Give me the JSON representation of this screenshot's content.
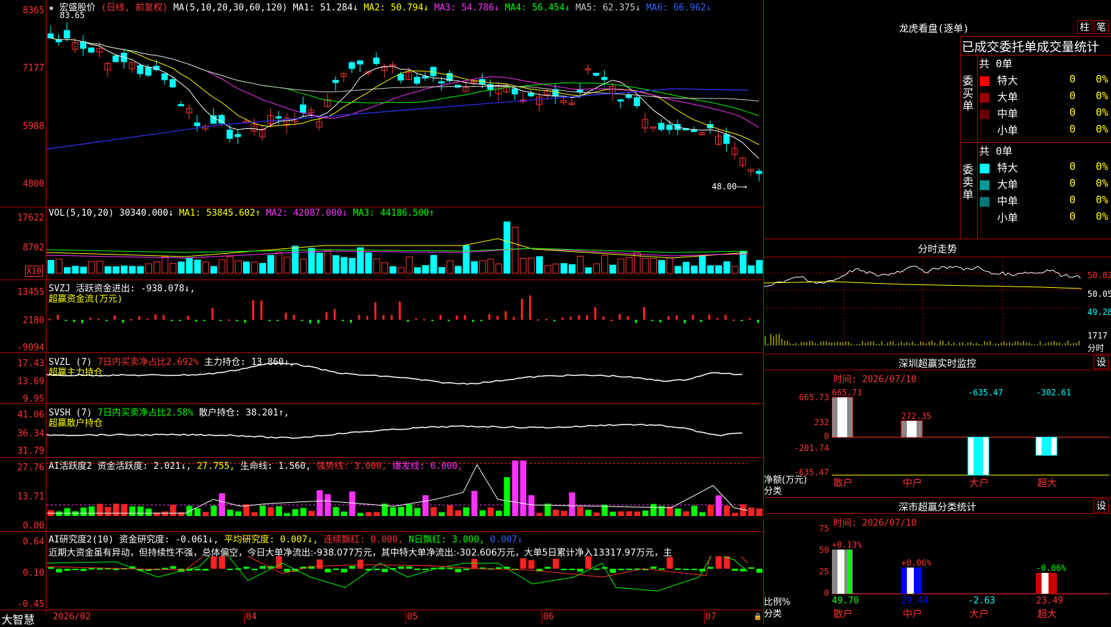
{
  "stock": {
    "name": "宏盛股价",
    "mode": "(日线, 前复权)"
  },
  "price_panel": {
    "ma_label": "MA(5,10,20,30,60,120)",
    "mas": [
      {
        "label": "MA1: 51.284↓",
        "color": "#ffffff"
      },
      {
        "label": "MA2: 50.794↓",
        "color": "#ffff00"
      },
      {
        "label": "MA3: 54.786↓",
        "color": "#ff33ff"
      },
      {
        "label": "MA4: 56.454↓",
        "color": "#00ff00"
      },
      {
        "label": "MA5: 62.375↓",
        "color": "#cccccc"
      },
      {
        "label": "MA6: 66.962↓",
        "color": "#3366ff"
      }
    ],
    "y_ticks": [
      "8365",
      "7177",
      "5988",
      "4800"
    ],
    "high_mark": "83.65",
    "low_mark": "48.00"
  },
  "vol_panel": {
    "title": "VOL(5,10,20)",
    "value": "30340.000↓",
    "ma1": "MA1: 53845.602↑",
    "ma2": "MA2: 42087.000↓",
    "ma3": "MA3: 44186.500↑",
    "y_ticks": [
      "17622",
      "8702"
    ],
    "unit": "X10"
  },
  "svzj_panel": {
    "title": "SVZJ",
    "label": "活跃资金进出: -938.078↓,",
    "sub": "超赢资金流(万元)",
    "y_ticks": [
      "13455",
      "2180",
      "-9094"
    ]
  },
  "svzl_panel": {
    "title": "SVZL (7)",
    "ratio": "7日内买卖净占比2.692%",
    "hold": "主力持仓: 13.860↓,",
    "sub": "超赢主力持仓",
    "y_ticks": [
      "17.43",
      "13.69",
      "9.95"
    ]
  },
  "svsh_panel": {
    "title": "SVSH (7)",
    "ratio": "7日内买卖净占比2.58%",
    "hold": "散户持仓: 38.201↑,",
    "sub": "超赢散户持仓",
    "y_ticks": [
      "41.06",
      "36.34",
      "31.79"
    ]
  },
  "ai_active_panel": {
    "title": "AI活跃度2",
    "a": "资金活跃度: 2.021↓,",
    "b": "27.755,",
    "c": "生命线: 1.560,",
    "d": "强势线: 3.000,",
    "e": "爆发线: 6.000,",
    "y_ticks": [
      "27.76",
      "13.71",
      "0.00"
    ]
  },
  "ai_research_panel": {
    "title": "AI研究度2(10)",
    "a": "资金研究度: -0.061↓,",
    "b": "平均研究度: 0.007↓,",
    "c": "连续飘红: 0.000,",
    "d": "N日飘红: 3.000,",
    "e": "0.007↓",
    "comment": "近期大资金虽有异动，但持续性不强，总体偏空，今日大单净流出:-938.077万元，其中特大单净流出:-302.606万元，大单5日累计净入13317.97万元，主",
    "y_ticks": [
      "0.64",
      "0.10",
      "-0.45"
    ]
  },
  "x_axis": {
    "brand": "大智慧",
    "labels": [
      "2026/02",
      "04",
      "05",
      "06",
      "07"
    ]
  },
  "right": {
    "dragon_title": "龙虎看盘(逐单)",
    "btn1": "柱",
    "btn2": "笔",
    "tabs_title": "已成交委托单成交量统计",
    "buy": {
      "label_chars": [
        "委",
        "买",
        "单"
      ],
      "total": "共 0单",
      "rows": [
        {
          "name": "特大",
          "v": "0",
          "p": "0%",
          "color": "#ff0000"
        },
        {
          "name": "大单",
          "v": "0",
          "p": "0%",
          "color": "#990000"
        },
        {
          "name": "中单",
          "v": "0",
          "p": "0%",
          "color": "#660000"
        },
        {
          "name": "小单",
          "v": "0",
          "p": "0%",
          "color": ""
        }
      ]
    },
    "sell": {
      "label_chars": [
        "委",
        "卖",
        "单"
      ],
      "total": "共 0单",
      "rows": [
        {
          "name": "特大",
          "v": "0",
          "p": "0%",
          "color": "#00ffff"
        },
        {
          "name": "大单",
          "v": "0",
          "p": "0%",
          "color": "#009999"
        },
        {
          "name": "中单",
          "v": "0",
          "p": "0%",
          "color": "#007777"
        },
        {
          "name": "小单",
          "v": "0",
          "p": "0%",
          "color": ""
        }
      ]
    },
    "intraday": {
      "title": "分时走势",
      "y_ticks": [
        "50.82",
        "50.05",
        "49.28"
      ],
      "vol": "1717",
      "vol_label": "分时"
    },
    "monitor": {
      "title": "深圳超赢实时监控",
      "btn": "设",
      "time": "时间: 2026/07/10",
      "y_ticks": [
        "665.73",
        "232",
        "0",
        "-201.74",
        "-635.47"
      ],
      "ylabel1": "净额(万元)",
      "ylabel2": "分类",
      "cats": [
        "散户",
        "中户",
        "大户",
        "超大"
      ]
    },
    "classify": {
      "title": "深市超赢分类统计",
      "btn": "设",
      "time": "时间: 2026/07/10",
      "y_ticks": [
        "75",
        "50",
        "25",
        "0"
      ],
      "ylabel1": "比例%",
      "ylabel2": "分类",
      "cats": [
        "散户",
        "中户",
        "大户",
        "超大"
      ]
    }
  },
  "chart_data": [
    {
      "type": "bar",
      "title": "深圳超赢实时监控",
      "categories": [
        "散户",
        "中户",
        "大户",
        "超大"
      ],
      "values": [
        665.73,
        272.35,
        -635.47,
        -302.61
      ],
      "ylim": [
        -635.47,
        665.73
      ],
      "ylabel": "净额(万元)",
      "xlabel": "分类"
    },
    {
      "type": "bar",
      "title": "深市超赢分类统计",
      "categories": [
        "散户",
        "中户",
        "大户",
        "超大"
      ],
      "values": [
        49.7,
        29.44,
        -2.63,
        23.49
      ],
      "change_labels": [
        "+0.13%",
        "+0.06%",
        "",
        "-0.06%"
      ],
      "ylim": [
        0,
        75
      ],
      "ylabel": "比例%",
      "xlabel": "分类"
    }
  ]
}
